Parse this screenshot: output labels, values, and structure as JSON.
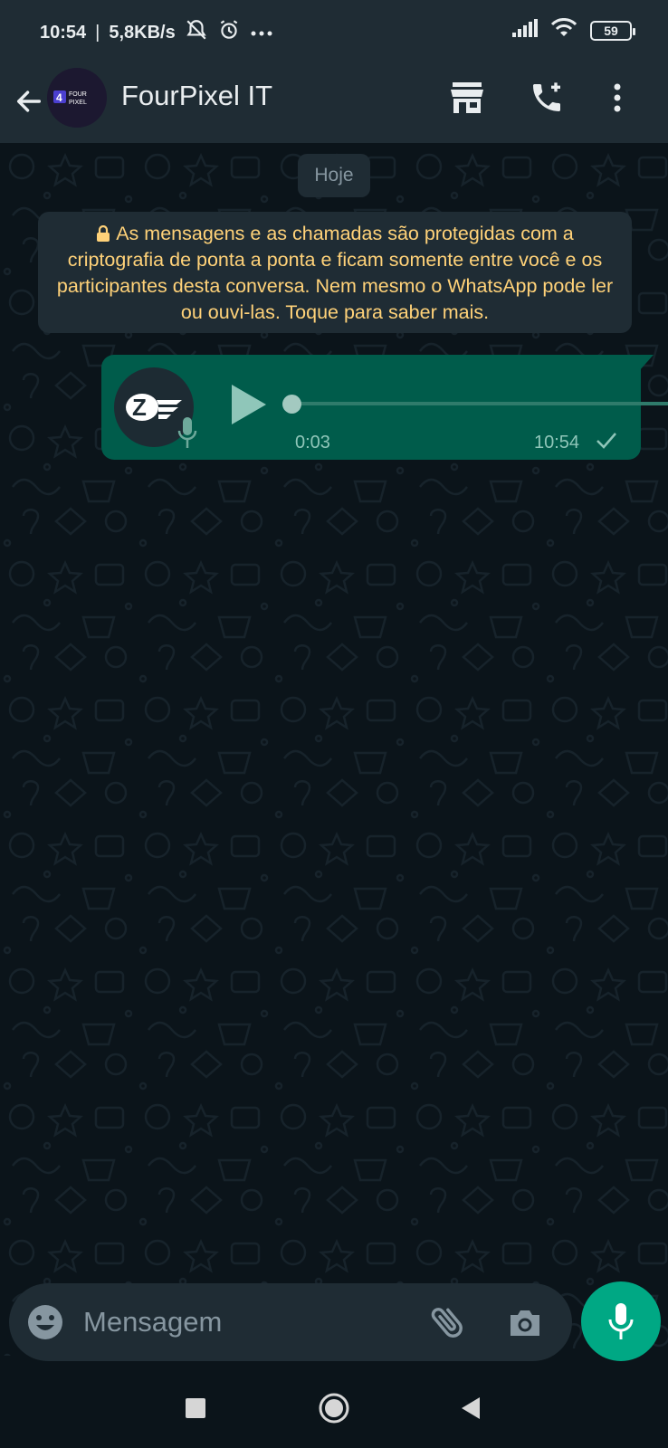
{
  "status_bar": {
    "time": "10:54",
    "separator": "|",
    "network_speed": "5,8KB/s",
    "battery": "59",
    "icons": [
      "alarm-off-icon",
      "alarm-clock-icon",
      "more-dots-icon",
      "signal-icon",
      "wifi-icon",
      "battery-icon"
    ]
  },
  "header": {
    "contact_name": "FourPixel IT",
    "avatar_logo": "FOUR PIXEL",
    "icons": [
      "back-arrow-icon",
      "store-icon",
      "add-call-icon",
      "kebab-menu-icon"
    ]
  },
  "chat": {
    "date_label": "Hoje",
    "encryption_notice": "As mensagens e as chamadas são protegidas com a criptografia de ponta a ponta e ficam somente entre você e os participantes desta conversa. Nem mesmo o WhatsApp pode ler ou ouvi-las. Toque para saber mais.",
    "voice_message": {
      "duration": "0:03",
      "time": "10:54",
      "progress": 0,
      "status": "sent"
    }
  },
  "input": {
    "placeholder": "Mensagem"
  },
  "colors": {
    "background": "#0b141a",
    "bar": "#1f2c34",
    "outgoing_bubble": "#005c4b",
    "accent": "#00a884",
    "notice_text": "#ffd279"
  }
}
